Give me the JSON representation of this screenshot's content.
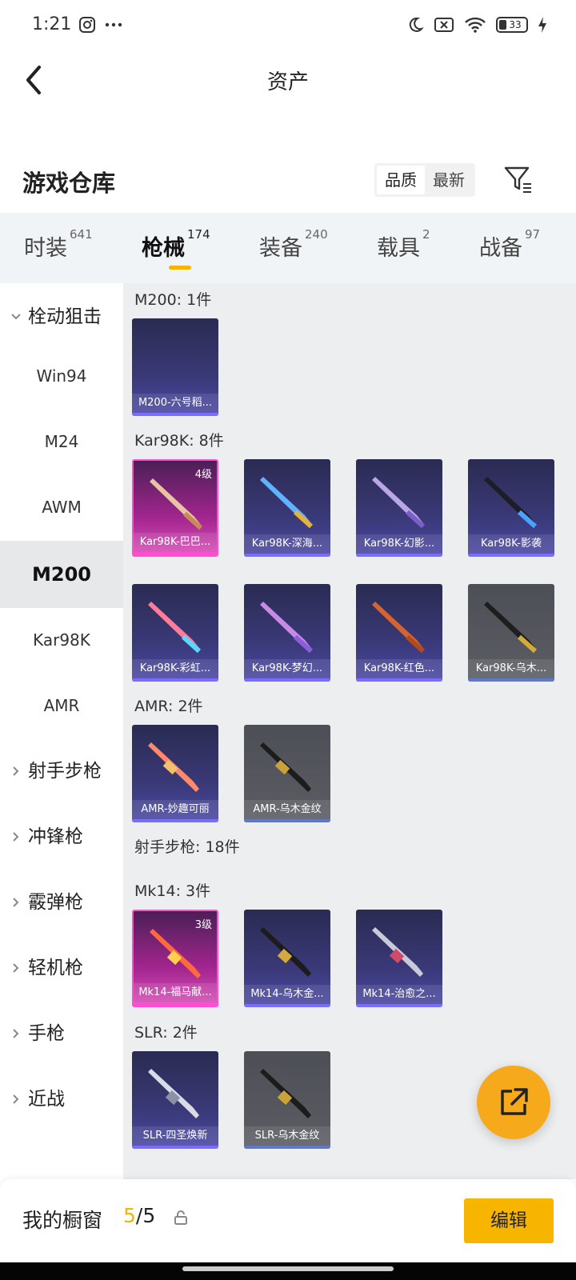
{
  "status": {
    "time": "1:21",
    "battery": "33"
  },
  "nav": {
    "title": "资产"
  },
  "section": {
    "title": "游戏仓库",
    "sort_options": [
      "品质",
      "最新"
    ]
  },
  "tabs": [
    {
      "label": "时装",
      "count": "641"
    },
    {
      "label": "枪械",
      "count": "174"
    },
    {
      "label": "装备",
      "count": "240"
    },
    {
      "label": "载具",
      "count": "2"
    },
    {
      "label": "战备",
      "count": "97"
    }
  ],
  "sidebar": {
    "expanded_category": "栓动狙击",
    "sub_items": [
      "Win94",
      "M24",
      "AWM",
      "M200",
      "Kar98K",
      "AMR"
    ],
    "categories": [
      "射手步枪",
      "冲锋枪",
      "霰弹枪",
      "轻机枪",
      "手枪",
      "近战"
    ]
  },
  "groups": {
    "m200": {
      "title": "M200: 1件",
      "items": [
        {
          "label": "M200-六号稻..."
        }
      ]
    },
    "kar98k": {
      "title": "Kar98K: 8件",
      "items": [
        {
          "label": "Kar98K-巴巴...",
          "level": "4级"
        },
        {
          "label": "Kar98K-深海..."
        },
        {
          "label": "Kar98K-幻影..."
        },
        {
          "label": "Kar98K-影袭"
        },
        {
          "label": "Kar98K-彩虹..."
        },
        {
          "label": "Kar98K-梦幻..."
        },
        {
          "label": "Kar98K-红色..."
        },
        {
          "label": "Kar98K-乌木..."
        }
      ]
    },
    "amr": {
      "title": "AMR: 2件",
      "items": [
        {
          "label": "AMR-妙趣可丽"
        },
        {
          "label": "AMR-乌木金纹"
        }
      ]
    },
    "marksman": {
      "title": "射手步枪: 18件"
    },
    "mk14": {
      "title": "Mk14: 3件",
      "items": [
        {
          "label": "Mk14-福马献...",
          "level": "3级"
        },
        {
          "label": "Mk14-乌木金..."
        },
        {
          "label": "Mk14-治愈之..."
        }
      ]
    },
    "slr": {
      "title": "SLR: 2件",
      "items": [
        {
          "label": "SLR-四圣焕新"
        },
        {
          "label": "SLR-乌木金纹"
        }
      ]
    }
  },
  "bottom": {
    "window_label": "我的橱窗",
    "current": "5",
    "separator": "/",
    "total": "5",
    "edit_label": "编辑"
  },
  "colors": {
    "accent": "#f5b400",
    "fab": "#f6a91b"
  }
}
